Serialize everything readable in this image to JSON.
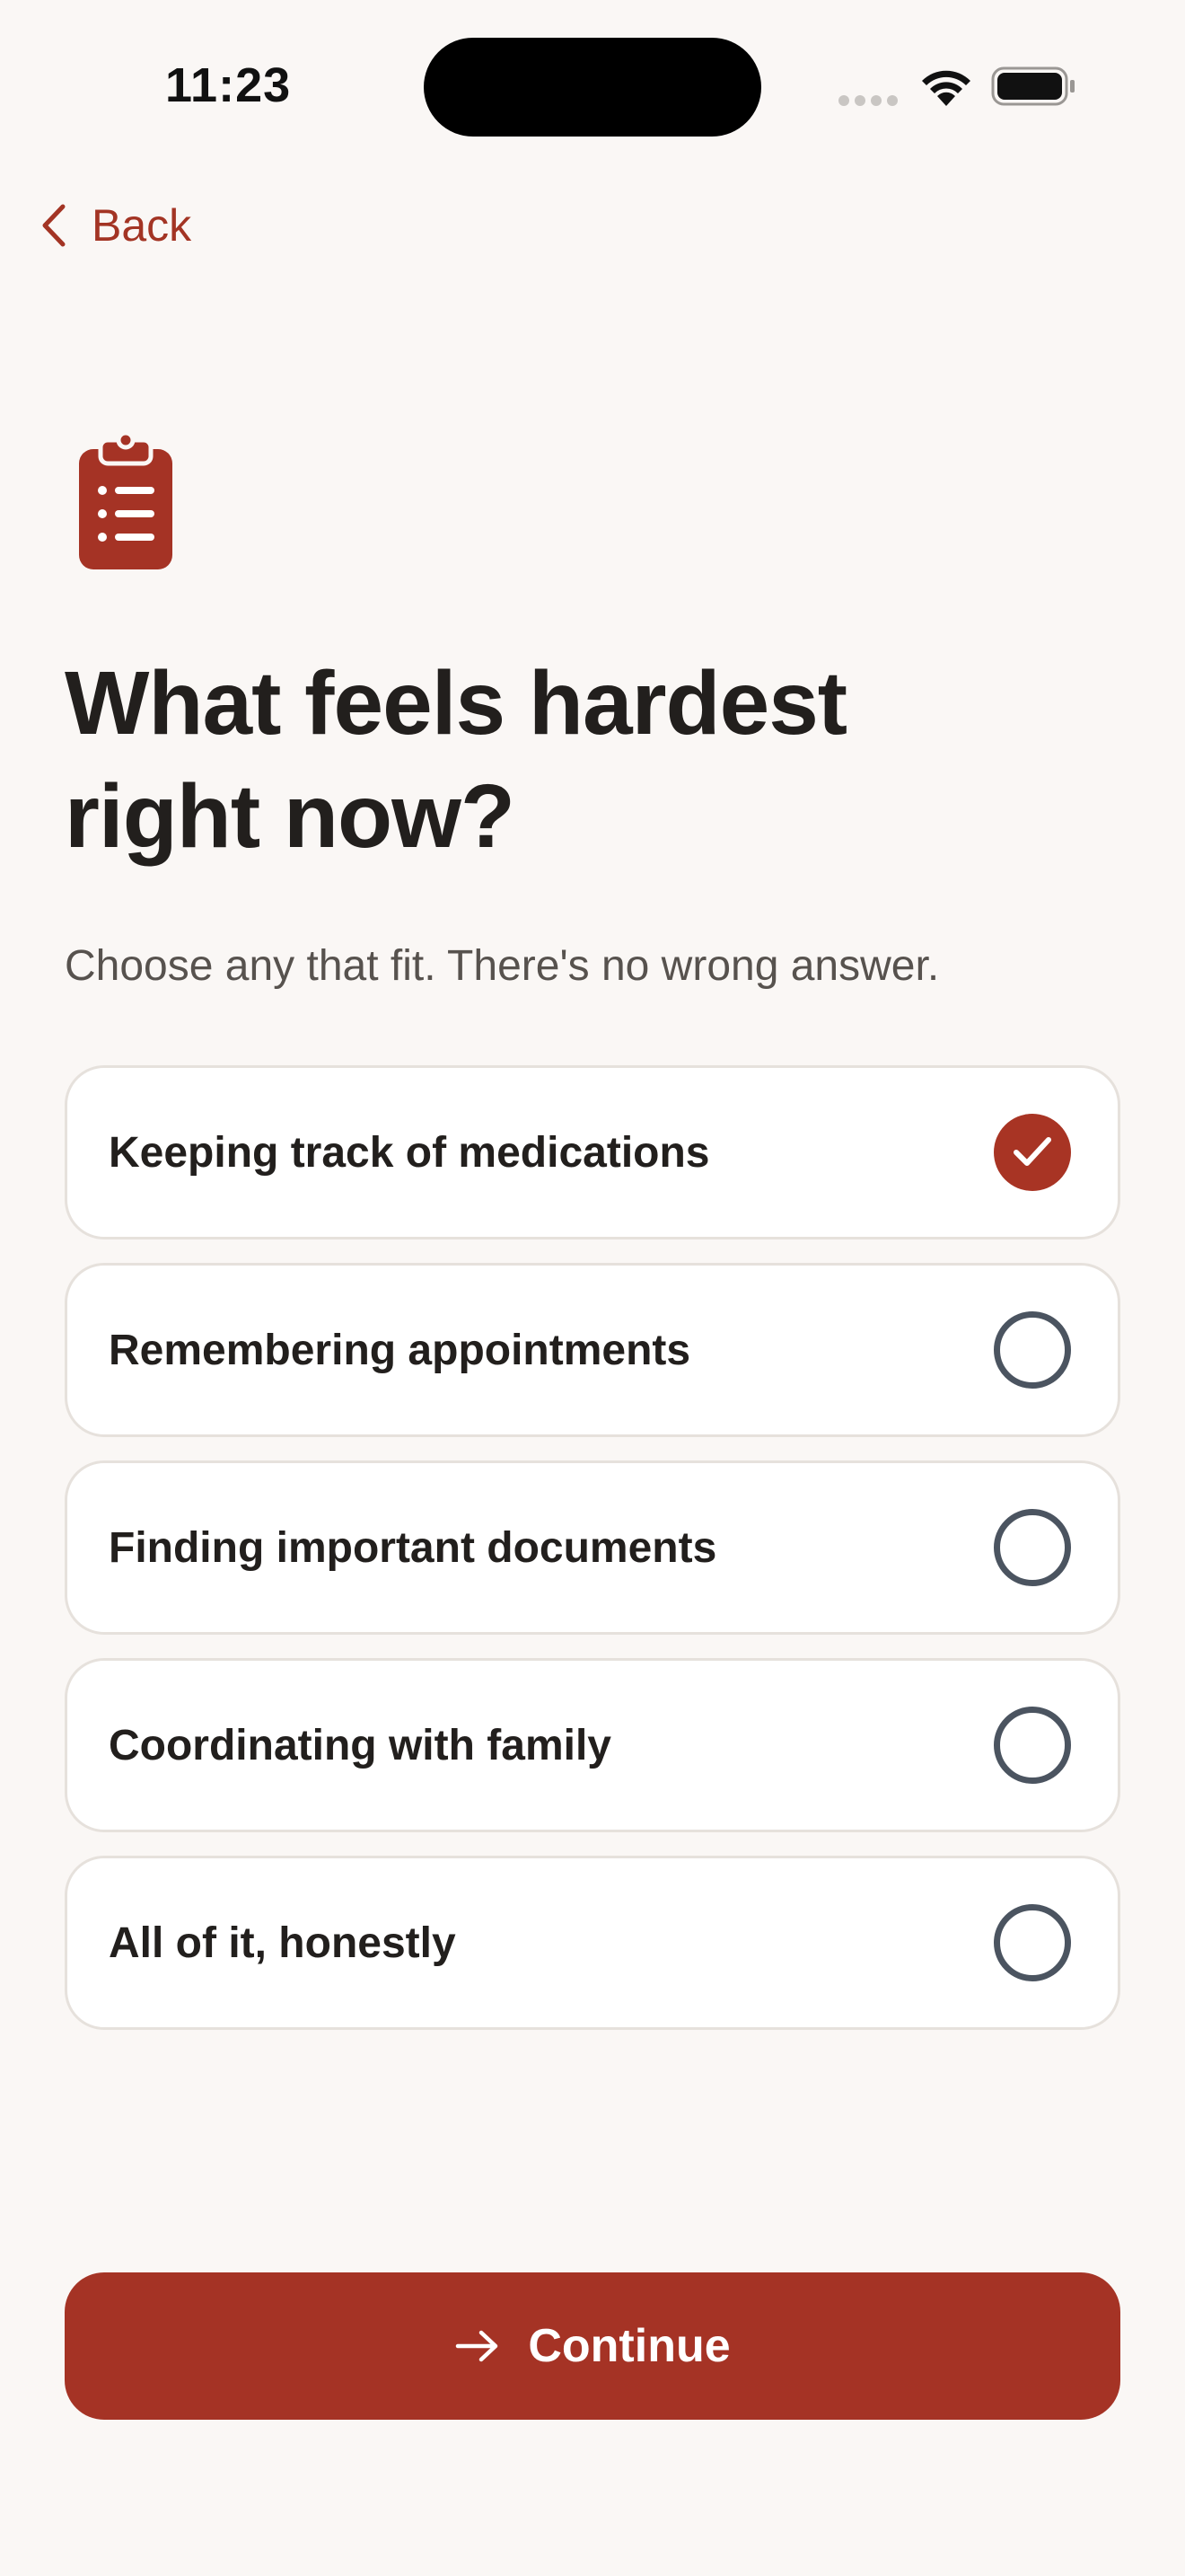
{
  "status_bar": {
    "time": "11:23",
    "icons": [
      "cellular-signal-icon",
      "wifi-icon",
      "battery-icon"
    ]
  },
  "nav": {
    "back_label": "Back",
    "back_icon": "chevron-left-icon"
  },
  "header": {
    "icon": "clipboard-list-icon",
    "title_line1": "What feels hardest",
    "title_line2": "right now?",
    "subtitle": "Choose any that fit. There's no wrong answer."
  },
  "options": [
    {
      "label": "Keeping track of medications",
      "selected": true
    },
    {
      "label": "Remembering appointments",
      "selected": false
    },
    {
      "label": "Finding important documents",
      "selected": false
    },
    {
      "label": "Coordinating with family",
      "selected": false
    },
    {
      "label": "All of it, honestly",
      "selected": false
    }
  ],
  "footer": {
    "continue_label": "Continue",
    "continue_icon": "arrow-right-icon"
  },
  "colors": {
    "accent": "#a53325",
    "background": "#faf7f5",
    "text": "#221f1d",
    "muted": "#57524e",
    "radio_border": "#4b5460"
  }
}
